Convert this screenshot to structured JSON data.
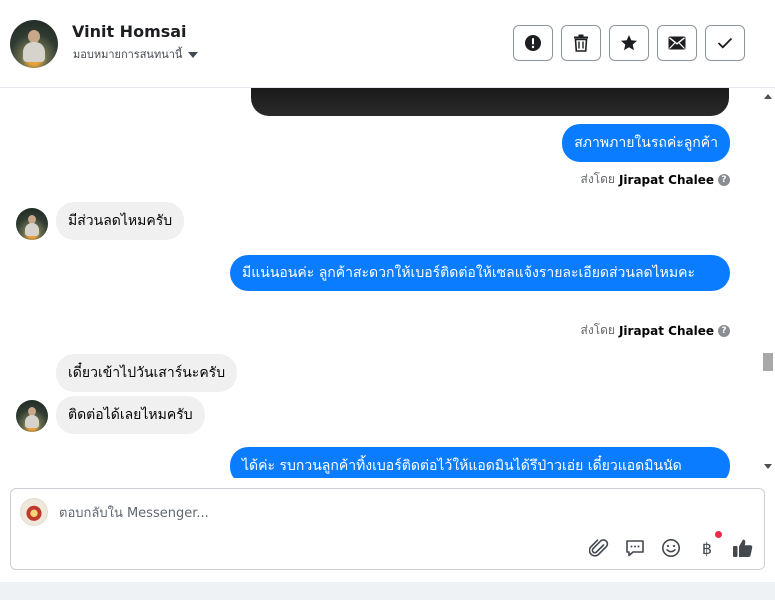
{
  "header": {
    "contact_name": "Vinit Homsai",
    "assignee_label": "มอบหมายการสนทนานี้",
    "actions": [
      "mark-spam",
      "delete",
      "star",
      "mark-unread",
      "mark-done"
    ]
  },
  "thread": {
    "messages": [
      {
        "text": "สภาพภายในรถค่ะลูกค้า"
      },
      {
        "sent_by_prefix": "ส่งโดย",
        "sent_by_name": "Jirapat Chalee"
      },
      {
        "text": "มีส่วนลดไหมครับ"
      },
      {
        "text": "มีแน่นอนค่ะ ลูกค้าสะดวกให้เบอร์ติดต่อให้เซลแจ้งรายละเอียดส่วนลดไหมคะ"
      },
      {
        "sent_by_prefix": "ส่งโดย",
        "sent_by_name": "Jirapat Chalee"
      },
      {
        "text": "เดี๋ยวเข้าไปวันเสาร์นะครับ"
      },
      {
        "text": "ติดต่อได้เลยไหมครับ"
      },
      {
        "text": "ได้ค่ะ รบกวนลูกค้าทิ้งเบอร์ติดต่อไว้ให้แอดมินได้รึป่าวเอ่ย เดี๋ยวแอดมินนัด"
      }
    ]
  },
  "composer": {
    "placeholder": "ตอบกลับใน Messenger...",
    "tools": [
      "paperclip-icon",
      "saved-replies-icon",
      "emoji-icon",
      "payment-baht-icon",
      "like-icon"
    ],
    "baht_symbol": "฿"
  },
  "colors": {
    "outgoing_bubble": "#0a7cff",
    "incoming_bubble": "#f0f0f0",
    "notification_dot": "#f02849"
  }
}
